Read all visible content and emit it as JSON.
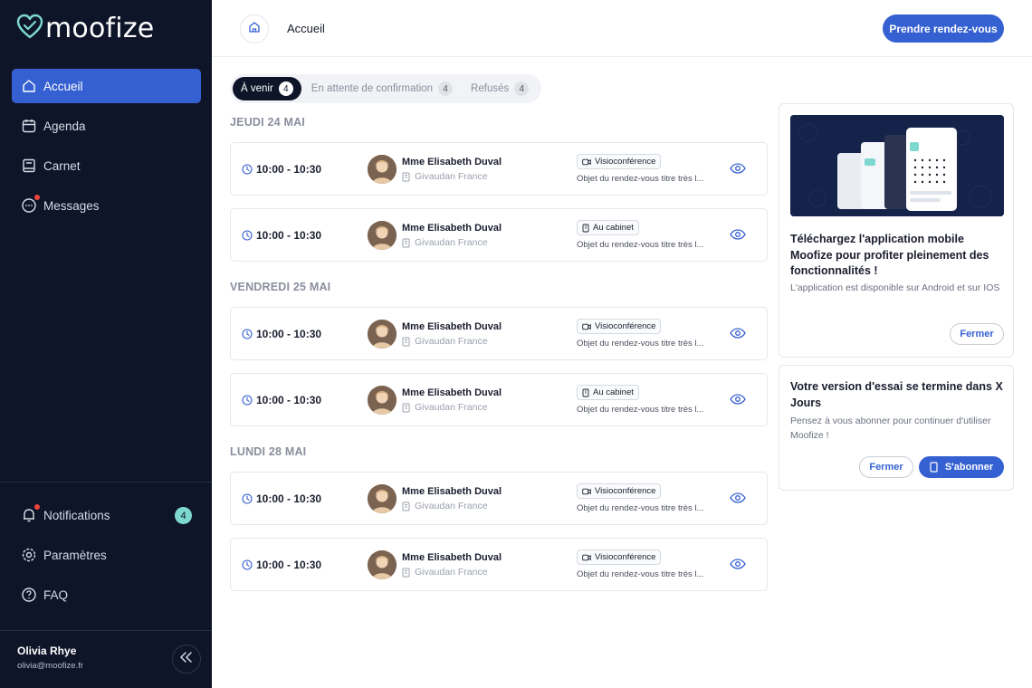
{
  "app": {
    "brand": "moofize"
  },
  "sidebar": {
    "nav": [
      {
        "label": "Accueil",
        "icon": "home-icon",
        "active": true
      },
      {
        "label": "Agenda",
        "icon": "calendar-icon"
      },
      {
        "label": "Carnet",
        "icon": "book-icon"
      },
      {
        "label": "Messages",
        "icon": "message-icon",
        "has_dot": true
      }
    ],
    "bottom": [
      {
        "label": "Notifications",
        "icon": "bell-icon",
        "has_dot": true,
        "count": "4"
      },
      {
        "label": "Paramètres",
        "icon": "gear-icon"
      },
      {
        "label": "FAQ",
        "icon": "question-icon"
      }
    ],
    "user": {
      "name": "Olivia Rhye",
      "email": "olivia@moofize.fr"
    }
  },
  "header": {
    "title": "Accueil",
    "cta": "Prendre rendez-vous"
  },
  "tabs": [
    {
      "label": "À venir",
      "count": "4",
      "active": true
    },
    {
      "label": "En attente de confirmation",
      "count": "4"
    },
    {
      "label": "Refusés",
      "count": "4"
    }
  ],
  "days": [
    {
      "label": "JEUDI 24 MAI",
      "appointments": [
        {
          "time": "10:00 - 10:30",
          "name": "Mme Elisabeth Duval",
          "company": "Givaudan France",
          "type": "Visioconférence",
          "type_icon": "video-icon",
          "subject": "Objet du rendez-vous titre très l..."
        },
        {
          "time": "10:00 - 10:30",
          "name": "Mme Elisabeth Duval",
          "company": "Givaudan France",
          "type": "Au cabinet",
          "type_icon": "building-icon",
          "subject": "Objet du rendez-vous titre très l..."
        }
      ]
    },
    {
      "label": "VENDREDI 25 MAI",
      "appointments": [
        {
          "time": "10:00 - 10:30",
          "name": "Mme Elisabeth Duval",
          "company": "Givaudan France",
          "type": "Visioconférence",
          "type_icon": "video-icon",
          "subject": "Objet du rendez-vous titre très l..."
        },
        {
          "time": "10:00 - 10:30",
          "name": "Mme Elisabeth Duval",
          "company": "Givaudan France",
          "type": "Au cabinet",
          "type_icon": "building-icon",
          "subject": "Objet du rendez-vous titre très l..."
        }
      ]
    },
    {
      "label": "LUNDI 28 MAI",
      "appointments": [
        {
          "time": "10:00 - 10:30",
          "name": "Mme Elisabeth Duval",
          "company": "Givaudan France",
          "type": "Visioconférence",
          "type_icon": "video-icon",
          "subject": "Objet du rendez-vous titre très l..."
        },
        {
          "time": "10:00 - 10:30",
          "name": "Mme Elisabeth Duval",
          "company": "Givaudan France",
          "type": "Visioconférence",
          "type_icon": "video-icon",
          "subject": "Objet du rendez-vous titre très l..."
        }
      ]
    }
  ],
  "promo_card": {
    "title": "Téléchargez l'application mobile Moofize pour profiter pleinement des fonctionnalités !",
    "text": "L'application est disponible sur Android et sur IOS",
    "close": "Fermer"
  },
  "trial_card": {
    "title": "Votre version d'essai se termine dans X Jours",
    "text": "Pensez à vous abonner pour continuer d'utiliser Moofize !",
    "close": "Fermer",
    "subscribe": "S'abonner"
  },
  "colors": {
    "sidebar_bg": "#0e1529",
    "accent": "#3560d1",
    "badge": "#7dd8cf",
    "dot": "#f0443a"
  }
}
